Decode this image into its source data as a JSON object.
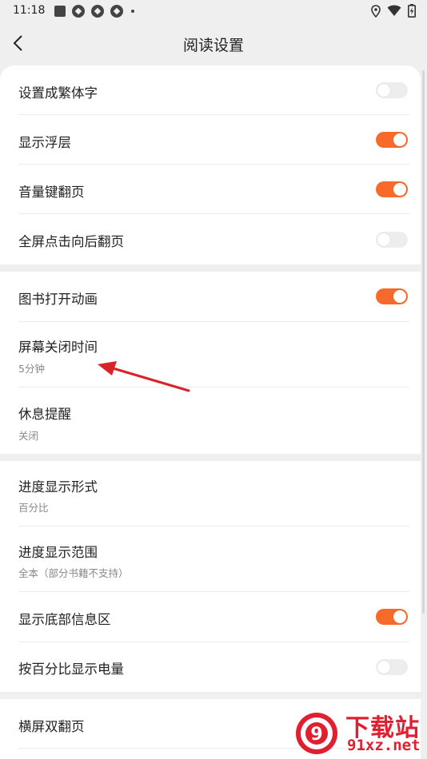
{
  "status_bar": {
    "time": "11:18",
    "icons": [
      "square-icon",
      "app-icon",
      "app-icon",
      "app-icon",
      "dot-icon",
      "location-icon",
      "wifi-icon",
      "battery-icon"
    ]
  },
  "nav": {
    "back_icon": "chevron-left-icon",
    "title": "阅读设置"
  },
  "colors": {
    "accent": "#f86a2a",
    "toggle_off": "#ededed",
    "background": "#efefef",
    "card": "#ffffff"
  },
  "sections": [
    {
      "items": [
        {
          "title": "设置成繁体字",
          "toggle": false
        },
        {
          "title": "显示浮层",
          "toggle": true
        },
        {
          "title": "音量键翻页",
          "toggle": true
        },
        {
          "title": "全屏点击向后翻页",
          "toggle": false
        }
      ]
    },
    {
      "items": [
        {
          "title": "图书打开动画",
          "toggle": true
        },
        {
          "title": "屏幕关闭时间",
          "subtitle": "5分钟"
        },
        {
          "title": "休息提醒",
          "subtitle": "关闭"
        }
      ]
    },
    {
      "items": [
        {
          "title": "进度显示形式",
          "subtitle": "百分比"
        },
        {
          "title": "进度显示范围",
          "subtitle": "全本（部分书籍不支持）"
        },
        {
          "title": "显示底部信息区",
          "toggle": true
        },
        {
          "title": "按百分比显示电量",
          "toggle": false
        }
      ]
    },
    {
      "items": [
        {
          "title": "横屏双翻页"
        }
      ]
    }
  ],
  "watermark": {
    "brand_top": "下载站",
    "brand_bottom": "91xz.net",
    "logo_text": "9"
  }
}
